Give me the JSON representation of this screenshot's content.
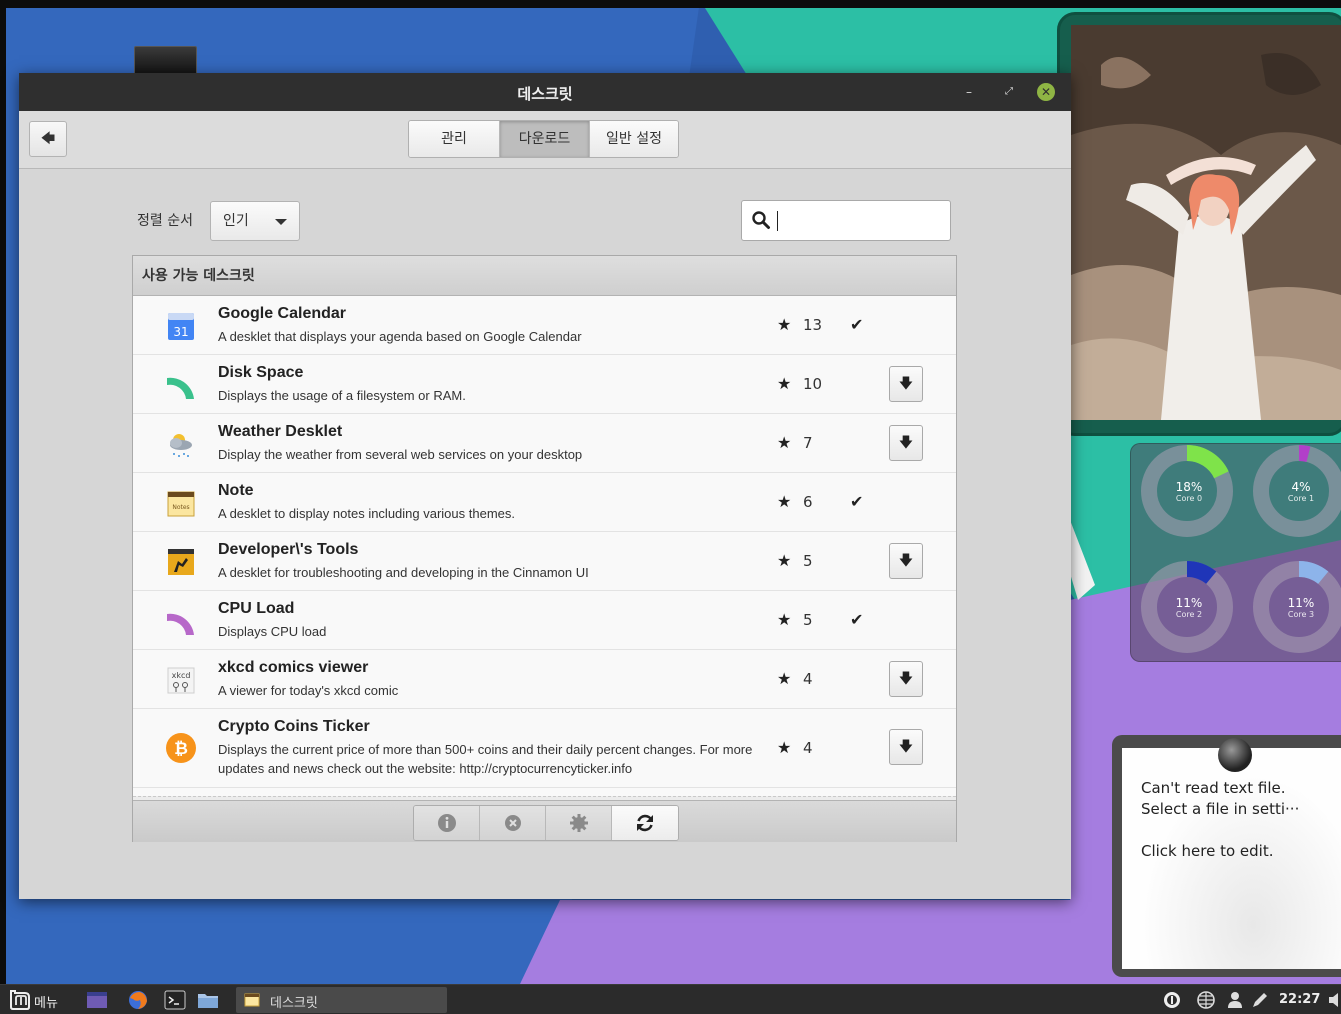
{
  "window": {
    "title": "데스크릿",
    "controls": {
      "minimize": "–",
      "maximize": "⤢",
      "close": "✕"
    }
  },
  "toolbar": {
    "back_icon": "arrow-left-icon",
    "tabs": [
      {
        "label": "관리",
        "active": false
      },
      {
        "label": "다운로드",
        "active": true
      },
      {
        "label": "일반 설정",
        "active": false
      }
    ]
  },
  "filters": {
    "sort_label": "정렬 순서",
    "sort_value": "인기",
    "search_value": "",
    "search_placeholder": ""
  },
  "list": {
    "header": "사용 가능 데스크릿",
    "items": [
      {
        "name": "Google Calendar",
        "desc": "A desklet that displays your agenda based on Google Calendar",
        "score": "13",
        "installed": true,
        "icon": "calendar-icon",
        "icon_text": "31"
      },
      {
        "name": "Disk Space",
        "desc": "Displays the usage of a filesystem or RAM.",
        "score": "10",
        "installed": false,
        "icon": "disk-arc-icon"
      },
      {
        "name": "Weather Desklet",
        "desc": "Display the weather from several web services on your desktop",
        "score": "7",
        "installed": false,
        "icon": "weather-icon"
      },
      {
        "name": "Note",
        "desc": "A desklet to display notes including various themes.",
        "score": "6",
        "installed": true,
        "icon": "notes-icon",
        "icon_text": "Notes"
      },
      {
        "name": "Developer\\'s Tools",
        "desc": "A desklet for troubleshooting and developing in the Cinnamon UI",
        "score": "5",
        "installed": false,
        "icon": "dev-tools-icon"
      },
      {
        "name": "CPU Load",
        "desc": "Displays CPU load",
        "score": "5",
        "installed": true,
        "icon": "cpu-arc-icon"
      },
      {
        "name": "xkcd comics viewer",
        "desc": "A viewer for today's xkcd comic",
        "score": "4",
        "installed": false,
        "icon": "xkcd-icon",
        "icon_text": "xkcd"
      },
      {
        "name": "Crypto Coins Ticker",
        "desc": "Displays the current price of more than 500+ coins and their daily percent changes. For more updates and news check out the website: http://cryptocurrencyticker.info",
        "score": "4",
        "installed": false,
        "icon": "bitcoin-icon"
      }
    ],
    "star_glyph": "★",
    "check_glyph": "✔",
    "download_glyph": "🡇"
  },
  "footer": {
    "buttons": [
      "info-icon",
      "uninstall-icon",
      "configure-icon",
      "refresh-icon"
    ]
  },
  "cpu_desklet": {
    "cores": [
      {
        "pct": "18%",
        "label": "Core 0",
        "value": 0.18,
        "color": "#7fe34a"
      },
      {
        "pct": "4%",
        "label": "Core 1",
        "value": 0.04,
        "color": "#b23fc9"
      },
      {
        "pct": "11%",
        "label": "Core 2",
        "value": 0.11,
        "color": "#1f35b8"
      },
      {
        "pct": "11%",
        "label": "Core 3",
        "value": 0.11,
        "color": "#8db4ea"
      }
    ]
  },
  "note_desklet": {
    "line1": "Can't read text file.",
    "line2": "Select a file in setti···",
    "line3": "Click here to edit."
  },
  "taskbar": {
    "menu_label": "메뉴",
    "task_label": "데스크릿",
    "clock": "22:27"
  },
  "colors": {
    "titlebar": "#2f2f2f",
    "accent_green": "#8fb544",
    "desktop_blue": "#2f5fb0",
    "desktop_teal": "#2cbfa5",
    "desktop_purple": "#a57de0"
  }
}
